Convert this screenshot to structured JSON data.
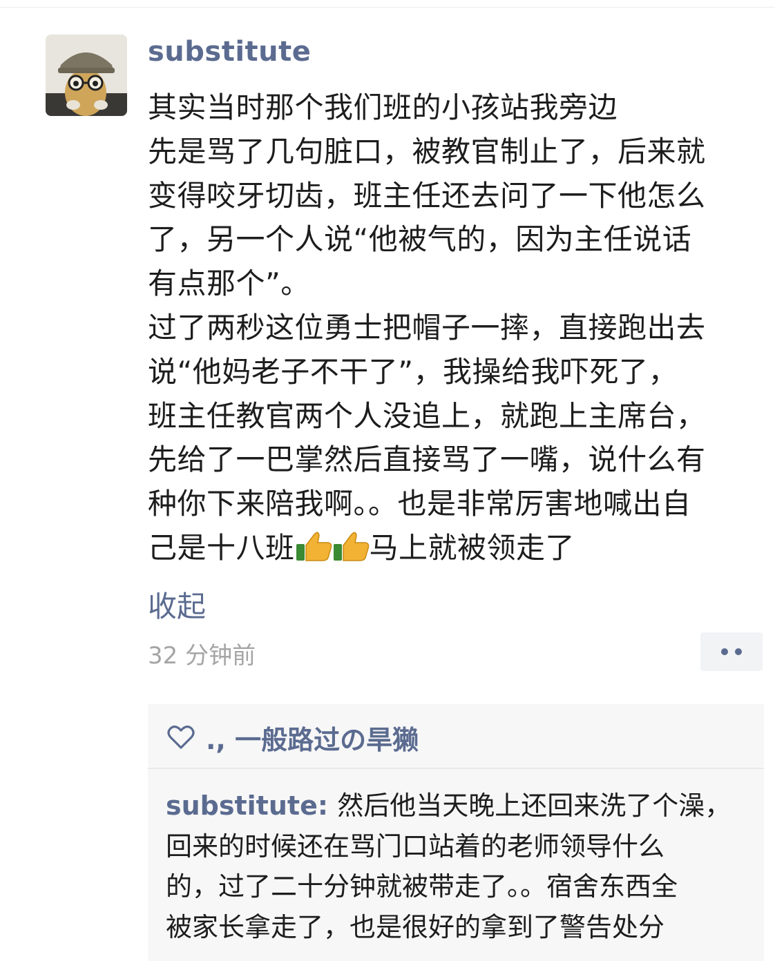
{
  "post": {
    "author": "substitute",
    "lines": [
      "其实当时那个我们班的小孩站我旁边",
      "先是骂了几句脏口，被教官制止了，后来就",
      "变得咬牙切齿，班主任还去问了一下他怎么",
      "了，另一个人说“他被气的，因为主任说话",
      "有点那个”。",
      "过了两秒这位勇士把帽子一摔，直接跑出去",
      "说“他妈老子不干了”，我操给我吓死了，",
      "班主任教官两个人没追上，就跑上主席台，",
      "先给了一巴掌然后直接骂了一嘴，说什么有",
      "种你下来陪我啊。。也是非常厉害地喊出自"
    ],
    "last_line_before_emoji": "己是十八班",
    "last_line_after_emoji": "马上就被领走了",
    "emoji": [
      "thumbs-up-icon",
      "thumbs-up-icon"
    ],
    "collapse_label": "收起",
    "timestamp": "32 分钟前"
  },
  "likes": {
    "names": "., 一般路过の旱獭"
  },
  "reply": {
    "author": "substitute",
    "separator": ": ",
    "first_line": "然后他当天晚上还回来洗了个澡，",
    "lines": [
      "回来的时候还在骂门口站着的老师领导什么",
      "的，过了二十分钟就被带走了。。宿舍东西全",
      "被家长拿走了，也是很好的拿到了警告处分"
    ]
  },
  "colors": {
    "link_blue": "#5b6b90",
    "text": "#1d1d1d",
    "timestamp_gray": "#a5a5a5",
    "comment_bg": "#f7f7f7"
  }
}
